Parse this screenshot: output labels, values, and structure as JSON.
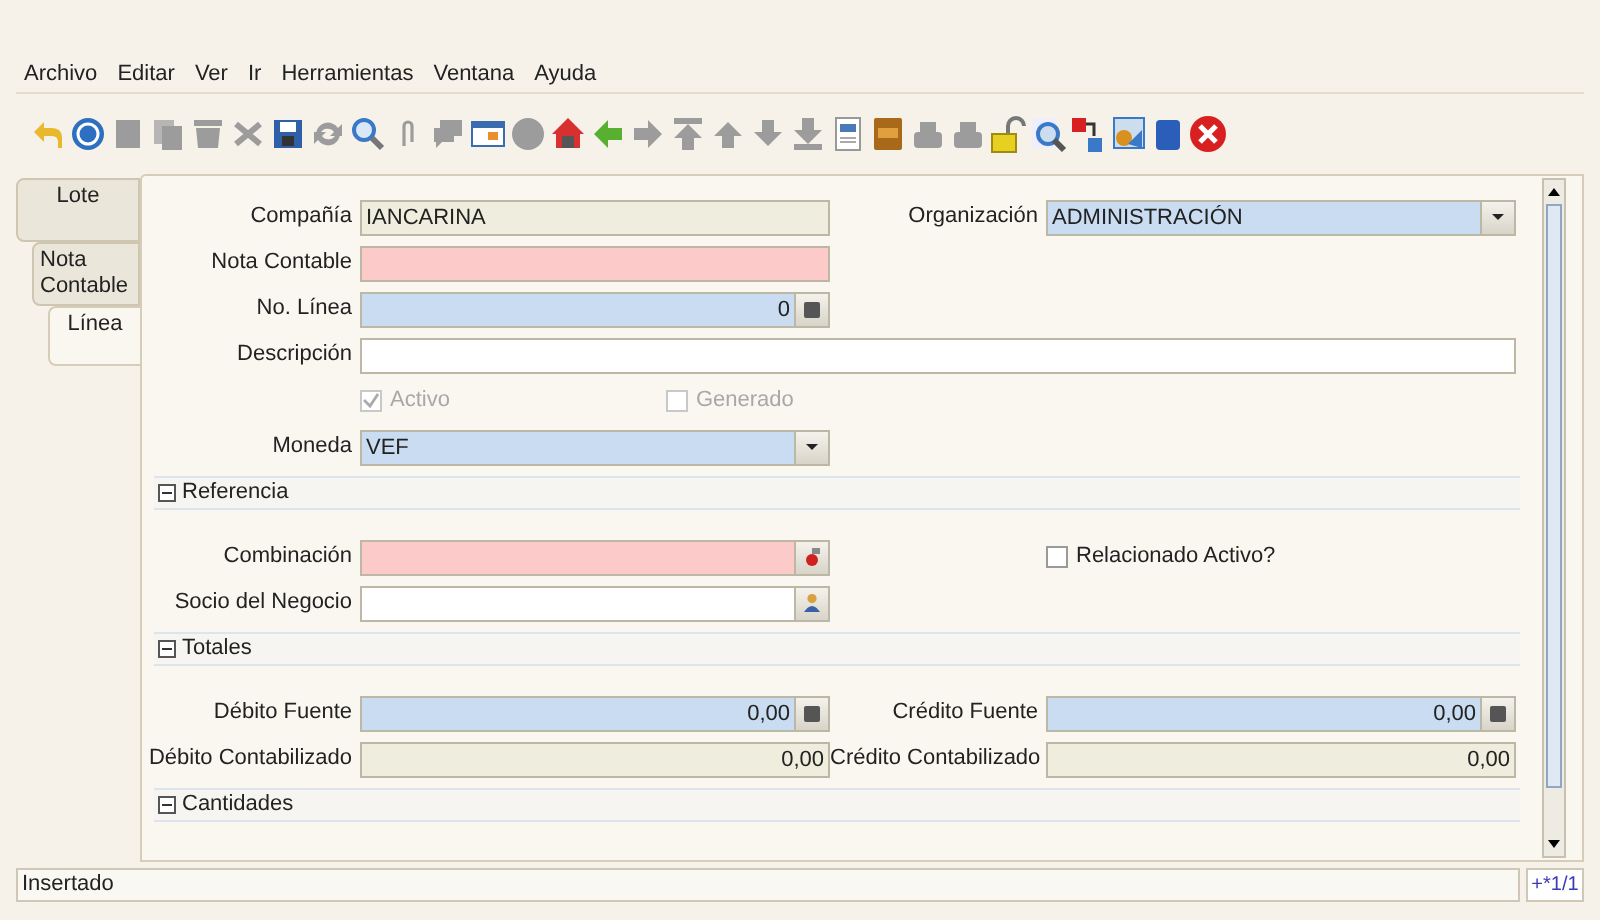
{
  "menu": [
    {
      "label": "Archivo"
    },
    {
      "label": "Editar"
    },
    {
      "label": "Ver"
    },
    {
      "label": "Ir"
    },
    {
      "label": "Herramientas"
    },
    {
      "label": "Ventana"
    },
    {
      "label": "Ayuda"
    }
  ],
  "toolbar": [
    {
      "disabled": false
    },
    {
      "disabled": false
    },
    {
      "disabled": true
    },
    {
      "disabled": true
    },
    {
      "disabled": true
    },
    {
      "disabled": true
    },
    {
      "disabled": false
    },
    {
      "disabled": true
    },
    {
      "disabled": false
    },
    {
      "disabled": true
    },
    {
      "disabled": true
    },
    {
      "disabled": false
    },
    {
      "disabled": true
    },
    {
      "disabled": false
    },
    {
      "disabled": false
    },
    {
      "disabled": true
    },
    {
      "disabled": true
    },
    {
      "disabled": true
    },
    {
      "disabled": true
    },
    {
      "disabled": true
    },
    {
      "disabled": false
    },
    {
      "disabled": false
    },
    {
      "disabled": true
    },
    {
      "disabled": true
    },
    {
      "disabled": false
    },
    {
      "disabled": false
    },
    {
      "disabled": false
    },
    {
      "disabled": false
    },
    {
      "disabled": false
    },
    {
      "disabled": false
    }
  ],
  "tabs": [
    {
      "label": "Lote",
      "selected": false,
      "children": [
        {
          "label": "Nota Contable",
          "selected": false,
          "children": [
            {
              "label": "Línea",
              "selected": true
            }
          ]
        }
      ]
    }
  ],
  "form": [
    {
      "left": {
        "kind": "text",
        "color": "#efeddd",
        "label": "Compañía",
        "value": "IANCARINA"
      },
      "right": {
        "kind": "combo",
        "color": "#c9dcf1",
        "label": "Organización",
        "value": "ADMINISTRACIÓN"
      }
    },
    {
      "left": {
        "kind": "text",
        "color": "#fdcaca",
        "label": "Nota Contable"
      }
    },
    {
      "left": {
        "kind": "number",
        "color": "#c9dcf1",
        "label": "No. Línea",
        "value": "0"
      }
    },
    {
      "left": {
        "kind": "text",
        "color": "#ffffff",
        "label": "Descripción",
        "wide": true
      }
    },
    {
      "left": {
        "kind": "checkbox",
        "label": "Activo",
        "checked": true,
        "disabled": true
      },
      "right": {
        "kind": "checkbox",
        "label": "Generado",
        "checked": false,
        "disabled": true
      }
    },
    {
      "left": {
        "kind": "combo",
        "color": "#c9dcf1",
        "label": "Moneda",
        "value": "VEF"
      }
    },
    {
      "kind": "section",
      "title": "Referencia",
      "expanded": true
    },
    {
      "left": {
        "kind": "account",
        "color": "#fdcaca",
        "label": "Combinación"
      },
      "right": {
        "kind": "checkbox",
        "label": "Relacionado Activo?",
        "checked": false,
        "disabled": false
      }
    },
    {
      "left": {
        "kind": "partner",
        "color": "#ffffff",
        "label": "Socio del Negocio"
      }
    },
    {
      "kind": "section",
      "title": "Totales",
      "expanded": true
    },
    {
      "left": {
        "kind": "number",
        "color": "#c9dcf1",
        "label": "Débito Fuente",
        "value": "0,00"
      },
      "right": {
        "kind": "number",
        "color": "#c9dcf1",
        "label": "Crédito Fuente",
        "value": "0,00"
      }
    },
    {
      "left": {
        "kind": "amount",
        "color": "#efeddd",
        "label": "Débito Contabilizado",
        "value": "0,00"
      },
      "right": {
        "kind": "amount",
        "color": "#efeddd",
        "label": "Crédito Contabilizado",
        "value": "0,00"
      }
    },
    {
      "kind": "section",
      "title": "Cantidades",
      "expanded": true
    }
  ],
  "status_bar": {
    "message": "Insertado",
    "record": "+*1/1"
  }
}
